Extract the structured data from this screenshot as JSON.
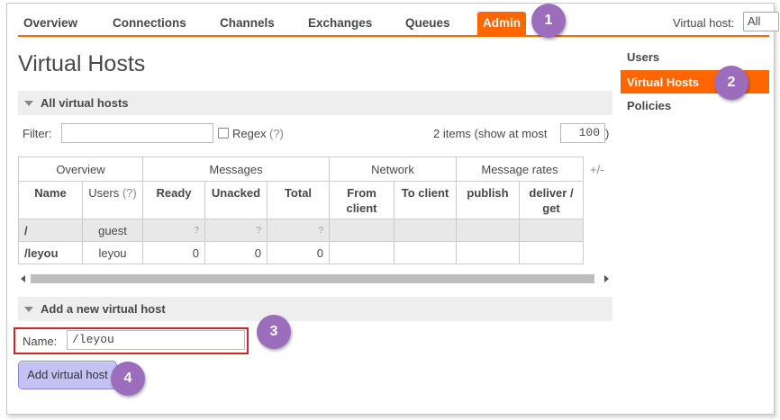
{
  "topnav": {
    "tabs": [
      {
        "label": "Overview"
      },
      {
        "label": "Connections"
      },
      {
        "label": "Channels"
      },
      {
        "label": "Exchanges"
      },
      {
        "label": "Queues"
      },
      {
        "label": "Admin",
        "active": true
      }
    ],
    "vhost_label": "Virtual host:",
    "vhost_value": "All"
  },
  "badges": [
    "1",
    "2",
    "3",
    "4"
  ],
  "sidebar": {
    "items": [
      {
        "label": "Users"
      },
      {
        "label": "Virtual Hosts",
        "active": true
      },
      {
        "label": "Policies"
      }
    ]
  },
  "page": {
    "title": "Virtual Hosts",
    "all_section": "All virtual hosts",
    "add_section": "Add a new virtual host"
  },
  "filter": {
    "label": "Filter:",
    "value": "",
    "regex_label": "Regex",
    "regex_help": "(?)",
    "items_text": "2 items (show at most",
    "max_value": "100",
    "close_paren": ")"
  },
  "table": {
    "groups": [
      "Overview",
      "Messages",
      "Network",
      "Message rates"
    ],
    "plus_minus": "+/-",
    "columns": [
      "Name",
      "Users",
      "Ready",
      "Unacked",
      "Total",
      "From client",
      "To client",
      "publish",
      "deliver / get"
    ],
    "users_help": "(?)",
    "rows": [
      {
        "name": "/",
        "users": "guest",
        "ready": "?",
        "unacked": "?",
        "total": "?",
        "from_client": "",
        "to_client": "",
        "publish": "",
        "deliver": ""
      },
      {
        "name": "/leyou",
        "users": "leyou",
        "ready": "0",
        "unacked": "0",
        "total": "0",
        "from_client": "",
        "to_client": "",
        "publish": "",
        "deliver": ""
      }
    ]
  },
  "form": {
    "name_label": "Name:",
    "name_value": "/leyou",
    "submit_label": "Add virtual host"
  },
  "colors": {
    "accent": "#ff6600",
    "badge": "#9b6dbc",
    "highlight_box": "#d3212d",
    "button": "#c4c2f4"
  }
}
